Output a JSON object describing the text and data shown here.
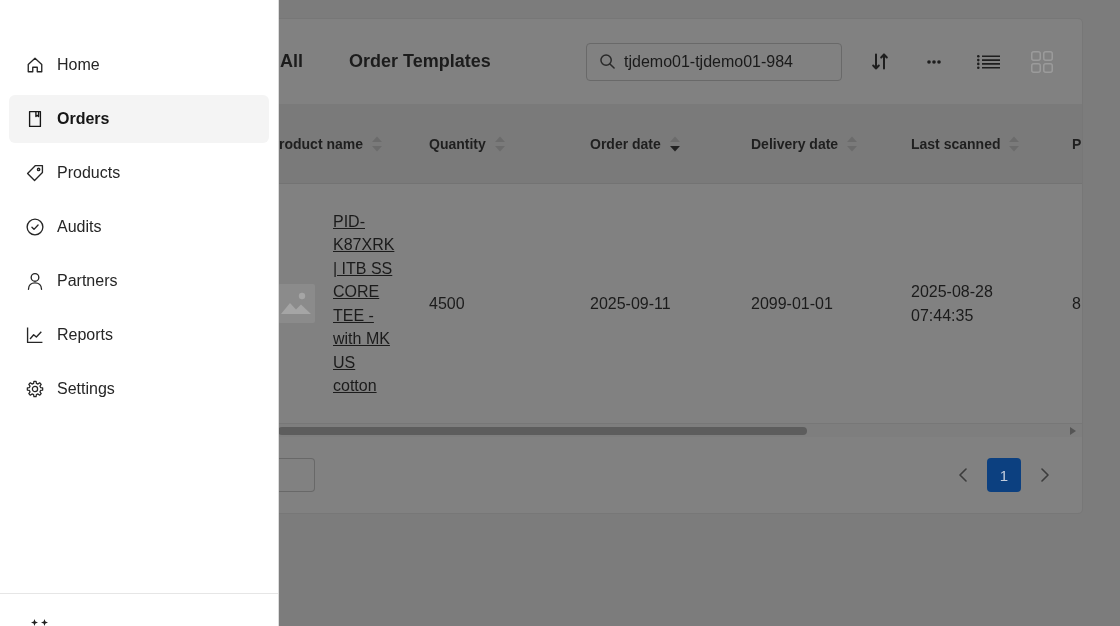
{
  "sidebar": {
    "items": [
      {
        "label": "Home",
        "selected": false
      },
      {
        "label": "Orders",
        "selected": true
      },
      {
        "label": "Products",
        "selected": false
      },
      {
        "label": "Audits",
        "selected": false
      },
      {
        "label": "Partners",
        "selected": false
      },
      {
        "label": "Reports",
        "selected": false
      },
      {
        "label": "Settings",
        "selected": false
      }
    ]
  },
  "toolbar": {
    "tabs": [
      {
        "label": "All"
      },
      {
        "label": "Order Templates"
      }
    ],
    "search": {
      "value": "tjdemo01-tjdemo01-984"
    },
    "view_modes": [
      {
        "selected": true
      },
      {
        "selected": false
      }
    ]
  },
  "table": {
    "columns": [
      {
        "label": "roduct name",
        "ascending": false,
        "descending": false
      },
      {
        "label": "Quantity",
        "ascending": false,
        "descending": false
      },
      {
        "label": "Order date",
        "ascending": false,
        "descending": true
      },
      {
        "label": "Delivery date",
        "ascending": false,
        "descending": false
      },
      {
        "label": "Last scanned",
        "ascending": false,
        "descending": false
      },
      {
        "label": "P"
      }
    ],
    "rows": [
      {
        "cells": [
          "PID-K87XRK | ITB SS CORE TEE - with MK US cotton",
          "4500",
          "2025-09-11",
          "2099-01-01",
          "2025-08-28 07:44:35",
          "8"
        ]
      }
    ]
  },
  "pagination": {
    "pages": [
      {
        "label": "1",
        "selected": true
      }
    ]
  }
}
